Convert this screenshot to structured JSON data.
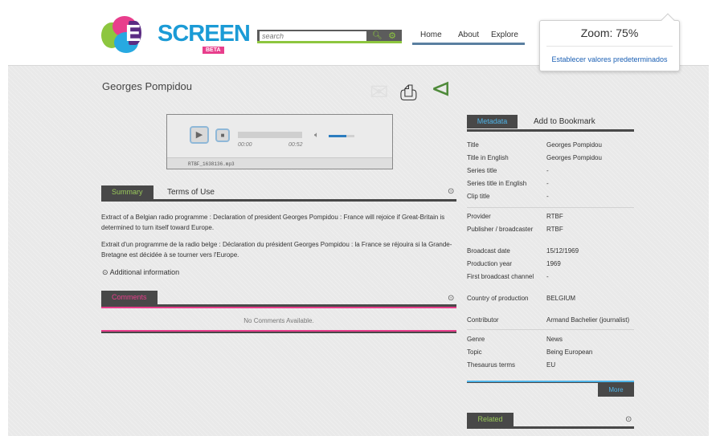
{
  "header": {
    "logo_text_eu": "EU",
    "logo_text_screen": "SCREEN",
    "logo_badge": "BETA",
    "search_placeholder": "search",
    "nav": [
      "Home",
      "About",
      "Explore"
    ]
  },
  "zoom_popup": {
    "title": "Zoom: 75%",
    "reset_label": "Establecer valores predeterminados"
  },
  "item": {
    "title": "Georges Pompidou"
  },
  "player": {
    "time_current": "00:00",
    "time_total": "00:52",
    "volume_level": 0.7,
    "filename": "RTBF_1638136.mp3"
  },
  "summary_tabs": {
    "active": "Summary",
    "other": "Terms of Use"
  },
  "summary": {
    "text_en": "Extract of a Belgian radio programme : Declaration of president Georges Pompidou : France will rejoice if Great-Britain is determined to turn itself toward Europe.",
    "text_fr": "Extrait d'un programme de la radio belge : Déclaration du président Georges Pompidou : la France se réjouira si la Grande-Bretagne est décidée à se tourner vers l'Europe.",
    "additional_info": "Additional information"
  },
  "comments": {
    "tab": "Comments",
    "empty": "No Comments Available."
  },
  "metadata_tabs": {
    "active": "Metadata",
    "other": "Add to Bookmark"
  },
  "metadata": {
    "group1": [
      {
        "k": "Title",
        "v": "Georges Pompidou"
      },
      {
        "k": "Title in English",
        "v": "Georges Pompidou"
      },
      {
        "k": "Series title",
        "v": "-"
      },
      {
        "k": "Series title in English",
        "v": "-"
      },
      {
        "k": "Clip title",
        "v": "-"
      }
    ],
    "group2": [
      {
        "k": "Provider",
        "v": "RTBF"
      },
      {
        "k": "Publisher / broadcaster",
        "v": "RTBF"
      },
      {
        "k": "Broadcast date",
        "v": "15/12/1969"
      },
      {
        "k": "Production year",
        "v": "1969"
      },
      {
        "k": "First broadcast channel",
        "v": "-"
      },
      {
        "k": "Country of production",
        "v": "BELGIUM"
      },
      {
        "k": "Contributor",
        "v": "Armand Bachelier (journalist)"
      }
    ],
    "group3": [
      {
        "k": "Genre",
        "v": "News"
      },
      {
        "k": "Topic",
        "v": "Being European"
      },
      {
        "k": "Thesaurus terms",
        "v": "EU"
      }
    ],
    "more_label": "More"
  },
  "related": {
    "tab": "Related"
  },
  "colors": {
    "accent_green": "#8dc63f",
    "accent_pink": "#e83e8c",
    "accent_blue": "#27a9e1",
    "tab_dark": "#484848"
  }
}
